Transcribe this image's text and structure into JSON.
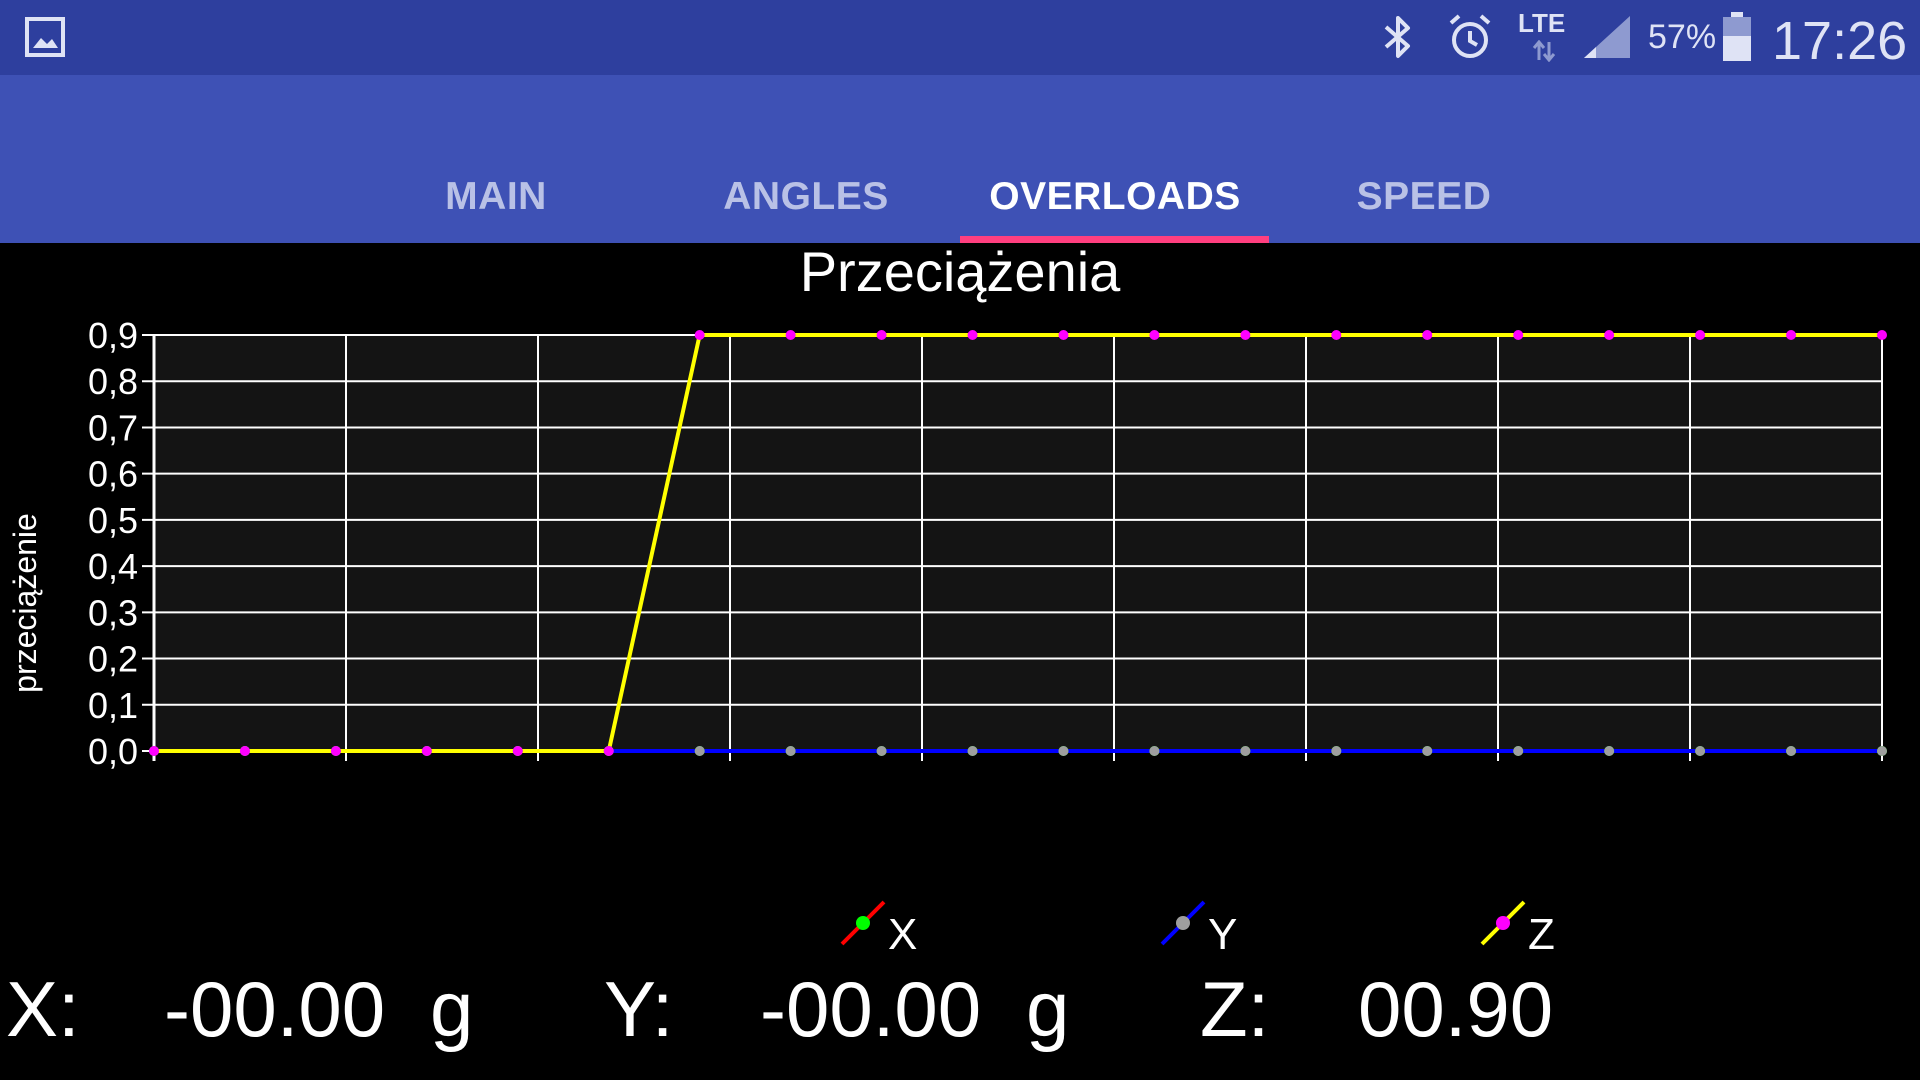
{
  "status_bar": {
    "icons": [
      "gallery-icon",
      "bluetooth-icon",
      "alarm-icon",
      "lte-icon",
      "signal-icon",
      "battery-icon"
    ],
    "network": "LTE",
    "battery": "57%",
    "time": "17:26"
  },
  "tabs": [
    {
      "label": "MAIN",
      "active": false
    },
    {
      "label": "ANGLES",
      "active": false
    },
    {
      "label": "OVERLOADS",
      "active": true
    },
    {
      "label": "SPEED",
      "active": false
    }
  ],
  "colors": {
    "status_bar": "#2e3f9e",
    "app_bar": "#3e51b5",
    "tab_indicator": "#ff3f7f",
    "plot_bg": "#141414",
    "grid": "#ffffff"
  },
  "chart_data": {
    "type": "line",
    "title": "Przeciążenia",
    "xlabel": "",
    "ylabel": "przeciążenie",
    "ylim": [
      0,
      0.9
    ],
    "y_ticks": [
      "0,0",
      "0,1",
      "0,2",
      "0,3",
      "0,4",
      "0,5",
      "0,6",
      "0,7",
      "0,8",
      "0,9"
    ],
    "grid": true,
    "x": [
      0,
      1,
      2,
      3,
      4,
      5,
      6,
      7,
      8,
      9,
      10,
      11,
      12,
      13,
      14,
      15,
      16,
      17,
      18,
      19
    ],
    "series": [
      {
        "name": "X",
        "color": "#ff0000",
        "marker_color": "#00ff00",
        "values": [
          0,
          0,
          0,
          0,
          0,
          0,
          0,
          0,
          0,
          0,
          0,
          0,
          0,
          0,
          0,
          0,
          0,
          0,
          0,
          0
        ]
      },
      {
        "name": "Y",
        "color": "#0000ff",
        "marker_color": "#9e9e9e",
        "values": [
          0,
          0,
          0,
          0,
          0,
          0,
          0,
          0,
          0,
          0,
          0,
          0,
          0,
          0,
          0,
          0,
          0,
          0,
          0,
          0
        ]
      },
      {
        "name": "Z",
        "color": "#ffff00",
        "marker_color": "#ff00ff",
        "values": [
          0,
          0,
          0,
          0,
          0,
          0,
          0.9,
          0.9,
          0.9,
          0.9,
          0.9,
          0.9,
          0.9,
          0.9,
          0.9,
          0.9,
          0.9,
          0.9,
          0.9,
          0.9
        ]
      }
    ]
  },
  "readings": {
    "x_label": "X:",
    "x_value": "-00.00",
    "x_unit": "g",
    "y_label": "Y:",
    "y_value": "-00.00",
    "y_unit": "g",
    "z_label": "Z:",
    "z_value": "00.90"
  }
}
